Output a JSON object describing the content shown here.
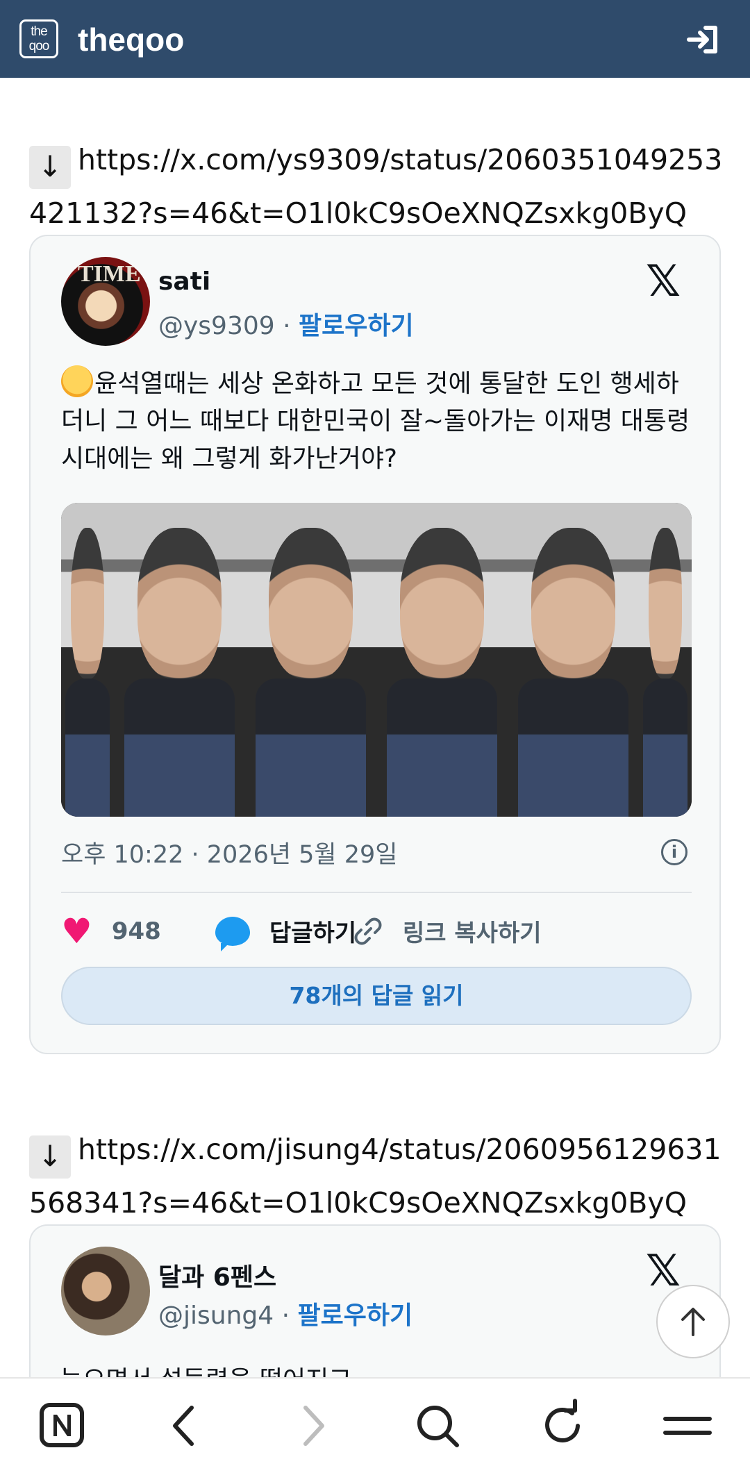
{
  "header": {
    "logo_text": "the qoo",
    "brand": "theqoo"
  },
  "posts": [
    {
      "link_arrow": "↓",
      "link": "https://x.com/ys9309/status/2060351049253421132?s=46&t=O1l0kC9sOeXNQZsxkg0ByQ",
      "tweet": {
        "name": "sati",
        "handle": "@ys9309",
        "separator": "·",
        "follow": "팔로우하기",
        "text": "윤석열때는 세상 온화하고 모든 것에 통달한 도인 행세하더니 그 어느 때보다 대한민국이 잘~돌아가는 이재명 대통령 시대에는 왜 그렇게 화가난거야?",
        "time": "오후 10:22 · 2026년 5월 29일",
        "likes": "948",
        "reply_label": "답글하기",
        "copy_link_label": "링크 복사하기",
        "read_replies": "78개의 답글 읽기"
      }
    },
    {
      "link_arrow": "↓",
      "link": "https://x.com/jisung4/status/2060956129631568341?s=46&t=O1l0kC9sOeXNQZsxkg0ByQ",
      "tweet": {
        "name": "달과 6펜스",
        "handle": "@jisung4",
        "separator": "·",
        "follow": "팔로우하기",
        "text_peek": "늙으면서 설득력을 떨어지고"
      }
    }
  ],
  "icons": {
    "login": "login-arrow-icon",
    "x_logo": "x-logo-icon",
    "info": "info-icon",
    "heart": "heart-icon",
    "reply": "speech-bubble-icon",
    "link": "chain-link-icon",
    "scroll_top": "arrow-up-icon"
  },
  "bottom_nav": [
    "naver-n-icon",
    "back-chevron-icon",
    "forward-chevron-icon",
    "search-icon",
    "refresh-icon",
    "menu-icon"
  ],
  "colors": {
    "header_bg": "#2f4b6b",
    "follow_blue": "#1d74c9",
    "like_pink": "#f01873",
    "reply_blue": "#1d9bf0",
    "replies_button_bg": "#dbe9f6"
  }
}
